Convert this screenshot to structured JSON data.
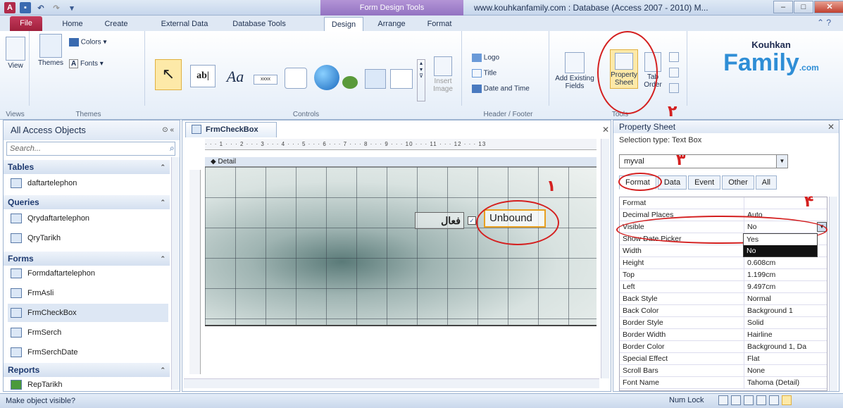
{
  "window": {
    "title": "www.kouhkanfamily.com : Database (Access 2007 - 2010) M...",
    "context_tab": "Form Design Tools",
    "help_label": "?"
  },
  "tabs": [
    "File",
    "Home",
    "Create",
    "External Data",
    "Database Tools",
    "Design",
    "Arrange",
    "Format"
  ],
  "ribbon": {
    "views": {
      "label": "View",
      "group": "Views"
    },
    "themes": {
      "themes_label": "Themes",
      "colors_label": "Colors",
      "fonts_label": "Fonts",
      "group": "Themes"
    },
    "controls": {
      "group": "Controls",
      "insert_image": "Insert Image",
      "textbox_icon": "ab|",
      "label_icon": "Aa",
      "button_icon": "xxxx"
    },
    "header_footer": {
      "logo": "Logo",
      "title": "Title",
      "date_time": "Date and Time",
      "group": "Header / Footer"
    },
    "tools": {
      "add_fields": "Add Existing Fields",
      "property_sheet": "Property Sheet",
      "tab_order": "Tab Order",
      "group": "Tools"
    },
    "brand": {
      "line1": "Kouhkan",
      "line2": "Family",
      "suffix": ".com"
    }
  },
  "nav": {
    "title": "All Access Objects",
    "search_placeholder": "Search...",
    "sections": [
      {
        "name": "Tables",
        "items": [
          "daftartelephon"
        ]
      },
      {
        "name": "Queries",
        "items": [
          "Qrydaftartelephon",
          "QryTarikh"
        ]
      },
      {
        "name": "Forms",
        "items": [
          "Formdaftartelephon",
          "FrmAsli",
          "FrmCheckBox",
          "FrmSerch",
          "FrmSerchDate"
        ]
      },
      {
        "name": "Reports",
        "items": [
          "RepTarikh"
        ]
      }
    ]
  },
  "document": {
    "tab": "FrmCheckBox",
    "ruler": "· · · 1 · · · 2 · · · 3 · · · 4 · · · 5 · · · 6 · · · 7 · · · 8 · · · 9 · · · 10 · · · 11 · · · 12 · · · 13",
    "section": "Detail",
    "label_text": "فعال",
    "textbox_text": "Unbound"
  },
  "property_sheet": {
    "title": "Property Sheet",
    "selection_type": "Selection type:  Text Box",
    "selected_control": "myval",
    "tabs": [
      "Format",
      "Data",
      "Event",
      "Other",
      "All"
    ],
    "active_tab": "Format",
    "rows": [
      {
        "name": "Format",
        "value": ""
      },
      {
        "name": "Decimal Places",
        "value": "Auto"
      },
      {
        "name": "Visible",
        "value": "No"
      },
      {
        "name": "Show Date Picker",
        "value": ""
      },
      {
        "name": "Width",
        "value": ""
      },
      {
        "name": "Height",
        "value": "0.608cm"
      },
      {
        "name": "Top",
        "value": "1.199cm"
      },
      {
        "name": "Left",
        "value": "9.497cm"
      },
      {
        "name": "Back Style",
        "value": "Normal"
      },
      {
        "name": "Back Color",
        "value": "Background 1"
      },
      {
        "name": "Border Style",
        "value": "Solid"
      },
      {
        "name": "Border Width",
        "value": "Hairline"
      },
      {
        "name": "Border Color",
        "value": "Background 1, Da"
      },
      {
        "name": "Special Effect",
        "value": "Flat"
      },
      {
        "name": "Scroll Bars",
        "value": "None"
      },
      {
        "name": "Font Name",
        "value": "Tahoma (Detail)"
      }
    ],
    "dropdown_options": [
      "Yes",
      "No"
    ],
    "dropdown_selected": "No"
  },
  "annotations": [
    "۱",
    "۲",
    "۳",
    "۴"
  ],
  "status": {
    "message": "Make object visible?",
    "numlock": "Num Lock"
  },
  "colors": {
    "accent_file": "#b02a4a",
    "context_tab": "#9b7bc8",
    "annotation": "#d42020"
  }
}
